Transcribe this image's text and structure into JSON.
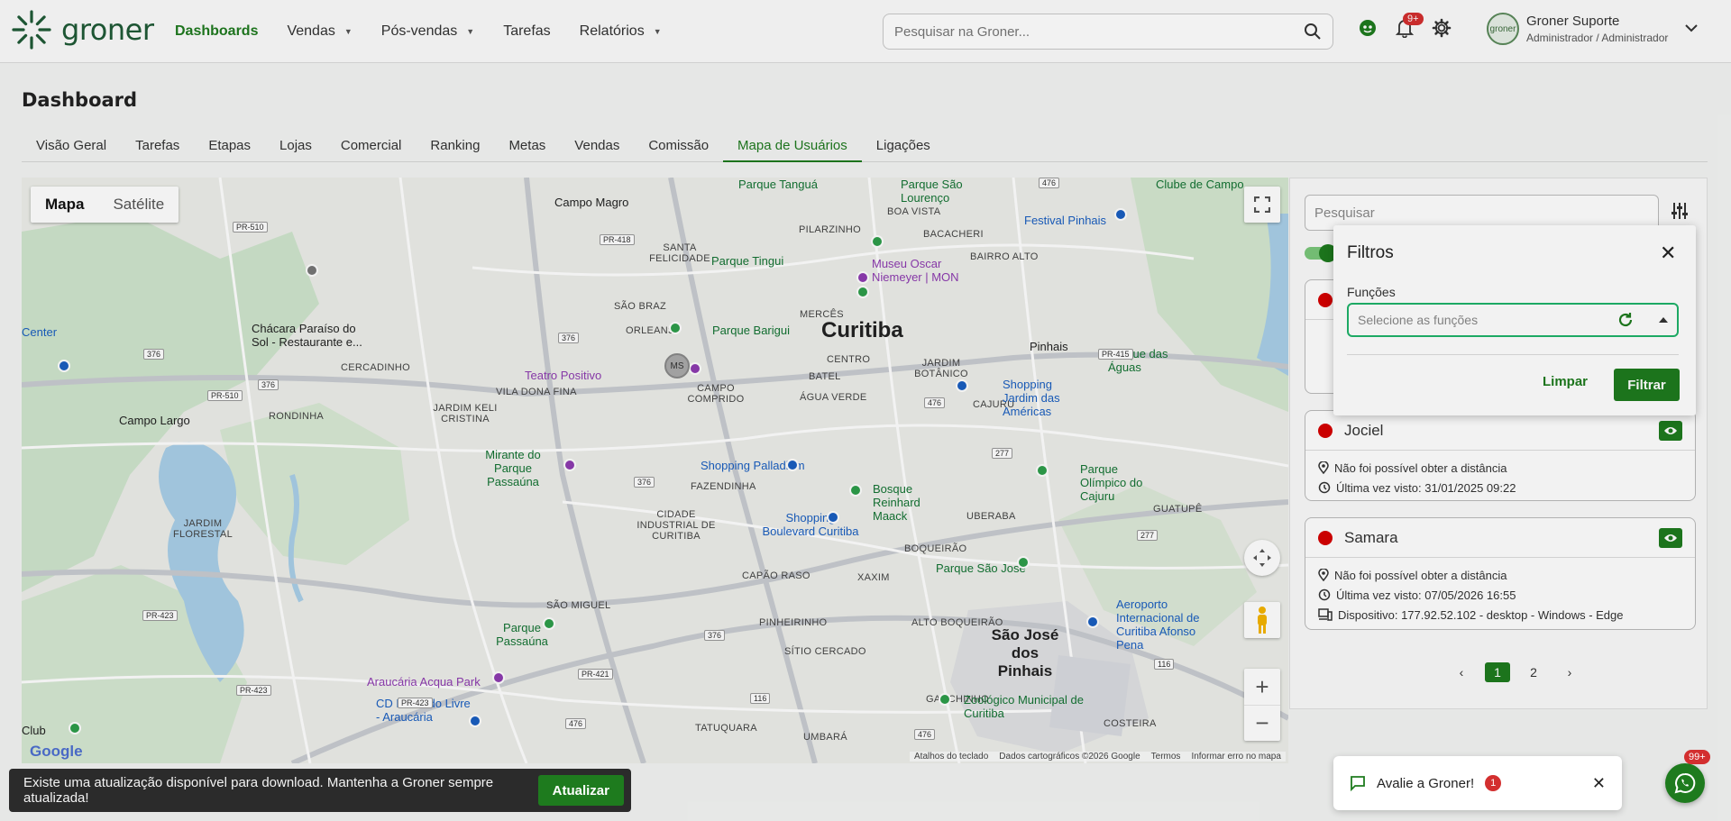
{
  "header": {
    "logo_text": "groner",
    "nav": [
      {
        "label": "Dashboards",
        "active": true,
        "caret": false
      },
      {
        "label": "Vendas",
        "caret": true
      },
      {
        "label": "Pós-vendas",
        "caret": true
      },
      {
        "label": "Tarefas",
        "caret": false
      },
      {
        "label": "Relatórios",
        "caret": true
      }
    ],
    "search_placeholder": "Pesquisar na Groner...",
    "notifications_badge": "9+",
    "user": {
      "name": "Groner Suporte",
      "role": "Administrador / Administrador",
      "avatar_text": "groner"
    }
  },
  "page": {
    "title": "Dashboard",
    "tabs": [
      "Visão Geral",
      "Tarefas",
      "Etapas",
      "Lojas",
      "Comercial",
      "Ranking",
      "Metas",
      "Vendas",
      "Comissão",
      "Mapa de Usuários",
      "Ligações"
    ],
    "active_tab": "Mapa de Usuários"
  },
  "map": {
    "type_toggle": {
      "map": "Mapa",
      "satellite": "Satélite"
    },
    "labels": {
      "curitiba": "Curitiba",
      "sjp": "São José dos Pinhais",
      "campo_magro": "Campo Magro",
      "campo_largo": "Campo Largo",
      "pinhais": "Pinhais",
      "santa_felicidade": "SANTA FELICIDADE",
      "sao_braz": "SÃO BRAZ",
      "orleans": "ORLEANS",
      "merces": "MERCÊS",
      "centro": "CENTRO",
      "batel": "BATEL",
      "agua_verde": "ÁGUA VERDE",
      "jardim_botanico": "JARDIM BOTÂNICO",
      "cajuru": "CAJURU",
      "bairro_alto": "BAIRRO ALTO",
      "bacacheri": "BACACHERI",
      "boa_vista": "BOA VISTA",
      "pilarzinho": "PILARZINHO",
      "cercadinho": "CERCADINHO",
      "vila_dona_fina": "VILA DONA FINA",
      "campo_comprido": "CAMPO COMPRIDO",
      "fazendinha": "FAZENDINHA",
      "cic": "CIDADE INDUSTRIAL DE CURITIBA",
      "uberaba": "UBERABA",
      "boqueirao": "BOQUEIRÃO",
      "xaxim": "XAXIM",
      "capao_raso": "CAPÃO RASO",
      "pinheirinho": "PINHEIRINHO",
      "sitio_cercado": "SÍTIO CERCADO",
      "guatupe": "GUATUPÊ",
      "tatuquara": "TATUQUARA",
      "umbara": "UMBARÁ",
      "costeira": "COSTEIRA",
      "ganchinho": "GANCHINHO",
      "sao_miguel": "SÃO MIGUEL",
      "jardim_florestal": "JARDIM FLORESTAL",
      "ronda": "RONDINHA",
      "alto_boqueirao": "ALTO BOQUEIRÃO",
      "vila_guarani": "JARDIM KELI CRISTINA"
    },
    "pois": {
      "parque_tangua": "Parque Tanguá",
      "parque_sao_lourenco": "Parque São Lourenço",
      "parque_tingui": "Parque Tingui",
      "museu": "Museu Oscar Niemeyer | MON",
      "parque_barigui": "Parque Barigui",
      "teatro_positivo": "Teatro Positivo",
      "chacara": "Chácara Paraíso do Sol - Restaurante e...",
      "mirante": "Mirante do Parque Passaúna",
      "palladium": "Shopping Palladium",
      "shopping_jardim": "Shopping Jardim das Américas",
      "bosque": "Bosque Reinhard Maack",
      "shopping_boulevard": "Shopping Boulevard Curitiba",
      "parque_olimpico": "Parque Olímpico do Cajuru",
      "festival": "Festival Pinhais",
      "clube": "Clube de Campo",
      "parque_sao_jose": "Parque São José",
      "aeroporto": "Aeroporto Internacional de Curitiba Afonso Pena",
      "parque_passauna": "Parque Passaúna",
      "araucaria": "Araucária Acqua Park",
      "cd_mercado": "CD Mercado Livre - Araucária",
      "zoologico": "Zoológico Municipal de Curitiba",
      "parque_das_aguas": "Parque das Águas",
      "center": "Center",
      "club": "Club"
    },
    "google_logo": "Google",
    "attribution": [
      "Atalhos do teclado",
      "Dados cartográficos ©2026 Google",
      "Termos",
      "Informar erro no mapa"
    ]
  },
  "panel": {
    "search_placeholder": "Pesquisar",
    "users": [
      {
        "name": "Jociel",
        "status_color": "#d50000",
        "lines": [
          "Não foi possível obter a distância",
          "Última vez visto: 31/01/2025 09:22"
        ]
      },
      {
        "name": "Samara",
        "status_color": "#d50000",
        "lines": [
          "Não foi possível obter a distância",
          "Última vez visto: 07/05/2026 16:55",
          "Dispositivo: 177.92.52.102 - desktop - Windows - Edge"
        ]
      }
    ],
    "pagination": {
      "pages": [
        "1",
        "2"
      ],
      "current": "1"
    }
  },
  "filters_popup": {
    "title": "Filtros",
    "field_label": "Funções",
    "select_placeholder": "Selecione as funções",
    "clear_label": "Limpar",
    "submit_label": "Filtrar"
  },
  "bottom": {
    "update_text": "Existe uma atualização disponível para download. Mantenha a Groner sempre atualizada!",
    "update_button": "Atualizar",
    "rate_text": "Avalie a Groner!",
    "rate_badge": "1",
    "whatsapp_badge": "99+"
  },
  "colors": {
    "brand": "#1e7b1e",
    "danger": "#d32f2f",
    "focus": "#1fb36a"
  }
}
